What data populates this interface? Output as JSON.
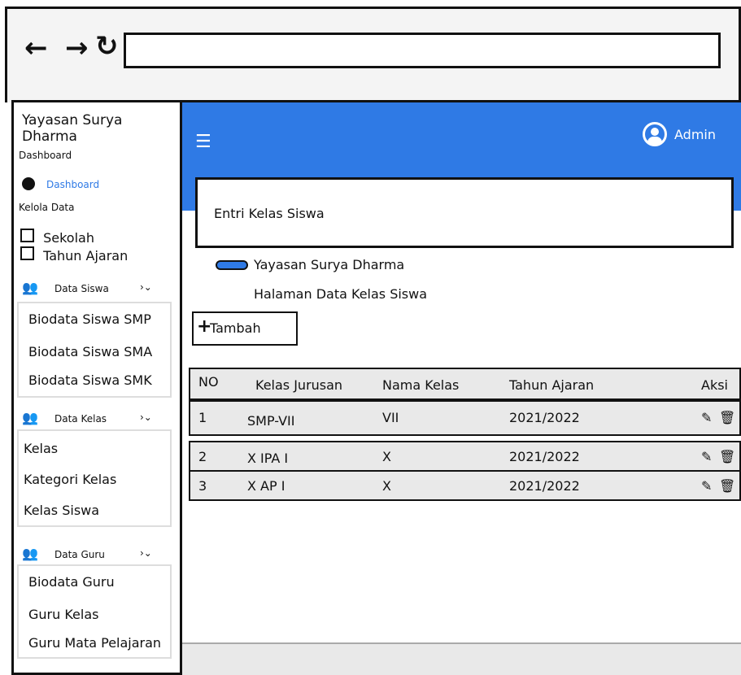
{
  "browser": {
    "back_glyph": "←",
    "forward_glyph": "→",
    "reload_glyph": "↻",
    "url": ""
  },
  "sidebar": {
    "brand": "Yayasan Surya Dharma",
    "sections": {
      "dashboard_heading": "Dashboard",
      "dashboard_link": "Dashboard",
      "kelola_heading": "Kelola Data",
      "sekolah": "Sekolah",
      "tahun_ajaran": "Tahun Ajaran"
    },
    "data_siswa": {
      "label": "Data Siswa",
      "chevron": "›⌄",
      "items": [
        "Biodata Siswa SMP",
        "Biodata Siswa SMA",
        "Biodata Siswa SMK"
      ]
    },
    "data_kelas": {
      "label": "Data Kelas",
      "chevron": "›⌄",
      "items": [
        "Kelas",
        "Kategori Kelas",
        "Kelas Siswa"
      ]
    },
    "data_guru": {
      "label": "Data Guru",
      "chevron": "›⌄",
      "items": [
        "Biodata Guru",
        "Guru Kelas",
        "Guru Mata Pelajaran"
      ]
    }
  },
  "header": {
    "menu_glyph": "☰",
    "user": "Admin"
  },
  "main": {
    "card_title": "Entri Kelas Siswa",
    "org_name": "Yayasan Surya Dharma",
    "page_subtitle": "Halaman Data Kelas Siswa",
    "tambah_plus": "+",
    "tambah_label": "Tambah"
  },
  "table": {
    "headers": [
      "NO",
      "Kelas Jurusan",
      "Nama Kelas",
      "Tahun Ajaran",
      "Aksi"
    ],
    "rows": [
      [
        "1",
        "SMP-VII",
        "VII",
        "2021/2022"
      ],
      [
        "2",
        "X IPA I",
        "X",
        "2021/2022"
      ],
      [
        "3",
        "X AP I",
        "X",
        "2021/2022"
      ]
    ],
    "edit_glyph": "✎",
    "delete_glyph": "🗑"
  },
  "colors": {
    "accent": "#2f7ae5"
  }
}
